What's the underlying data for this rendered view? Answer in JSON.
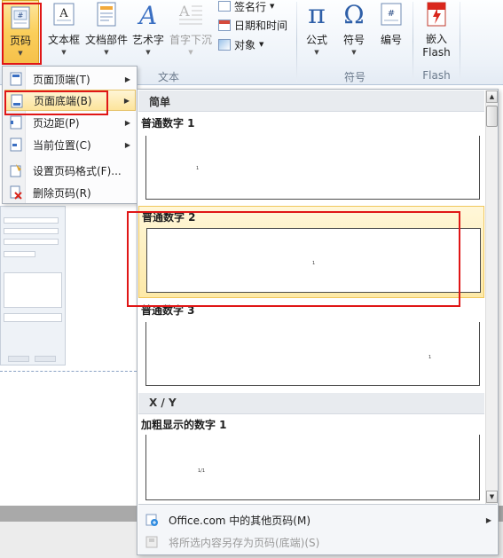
{
  "ribbon": {
    "page_number": "页码",
    "text_box": "文本框",
    "quick_parts": "文档部件",
    "wordart": "艺术字",
    "drop_cap": "首字下沉",
    "signature_line": "签名行",
    "date_time": "日期和时间",
    "object": "对象",
    "equation": "公式",
    "symbol": "符号",
    "numbering": "编号",
    "embed_flash": "嵌入",
    "embed_flash_2": "Flash",
    "group_text": "文本",
    "group_symbols": "符号",
    "group_flash": "Flash"
  },
  "context_menu": {
    "items": [
      {
        "label": "页面顶端(T)",
        "icon": "page-top-icon",
        "submenu": true
      },
      {
        "label": "页面底端(B)",
        "icon": "page-bottom-icon",
        "submenu": true,
        "highlighted": true
      },
      {
        "label": "页边距(P)",
        "icon": "page-margin-icon",
        "submenu": true
      },
      {
        "label": "当前位置(C)",
        "icon": "current-position-icon",
        "submenu": true
      },
      {
        "label": "设置页码格式(F)...",
        "icon": "format-page-number-icon",
        "submenu": false
      },
      {
        "label": "删除页码(R)",
        "icon": "remove-page-number-icon",
        "submenu": false
      }
    ]
  },
  "gallery": {
    "section_simple": "简单",
    "section_xy": "X / Y",
    "items": [
      {
        "label": "普通数字 1",
        "sample": "1"
      },
      {
        "label": "普通数字 2",
        "sample": "1"
      },
      {
        "label": "普通数字 3",
        "sample": "1"
      },
      {
        "label": "加粗显示的数字 1",
        "sample": "1/1"
      }
    ],
    "footer": {
      "more_online": "Office.com 中的其他页码(M)",
      "save_selection": "将所选内容另存为页码(底端)(S)"
    }
  },
  "colors": {
    "highlight_bg": "#fde49b",
    "annotation_red": "#e01616",
    "ribbon_group_label": "#6b7a8c"
  }
}
